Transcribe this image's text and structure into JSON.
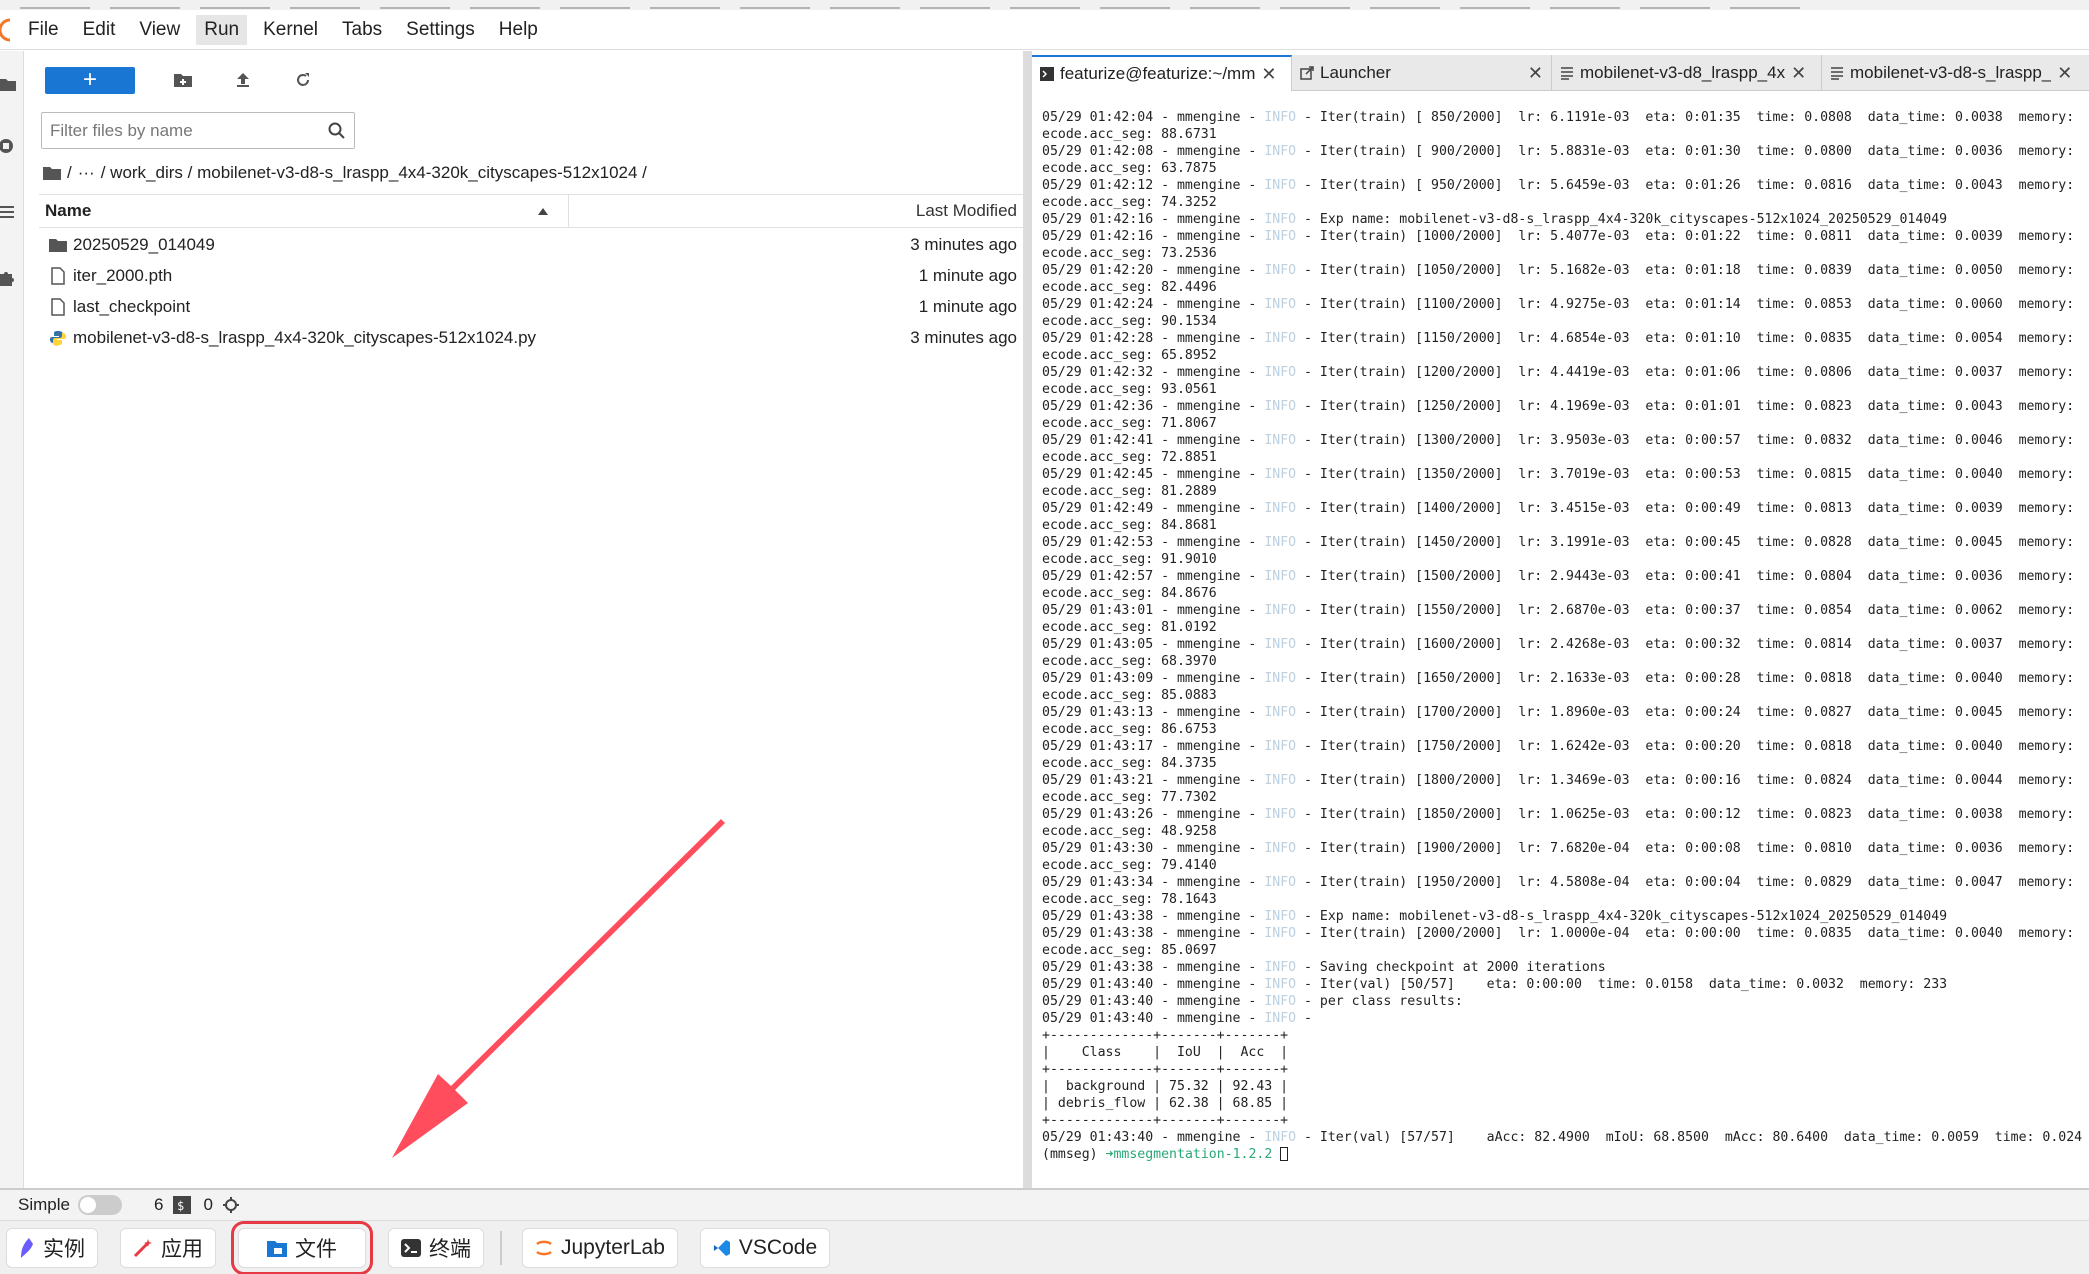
{
  "menubar": {
    "items": [
      "File",
      "Edit",
      "View",
      "Run",
      "Kernel",
      "Tabs",
      "Settings",
      "Help"
    ],
    "active_index": 3
  },
  "filebrowser": {
    "new_label": "+",
    "filter_placeholder": "Filter files by name",
    "breadcrumb": {
      "root": "/",
      "ellipsis": "···",
      "path": "/ work_dirs / mobilenet-v3-d8-s_lraspp_4x4-320k_cityscapes-512x1024 /"
    },
    "columns": {
      "name": "Name",
      "modified": "Last Modified"
    },
    "files": [
      {
        "name": "20250529_014049",
        "modified": "3 minutes ago",
        "icon": "folder-icon"
      },
      {
        "name": "iter_2000.pth",
        "modified": "1 minute ago",
        "icon": "file-icon"
      },
      {
        "name": "last_checkpoint",
        "modified": "1 minute ago",
        "icon": "file-icon"
      },
      {
        "name": "mobilenet-v3-d8-s_lraspp_4x4-320k_cityscapes-512x1024.py",
        "modified": "3 minutes ago",
        "icon": "python-file-icon"
      }
    ]
  },
  "terminal": {
    "tabs": [
      {
        "label": "featurize@featurize:~/mm",
        "icon": "terminal-icon",
        "active": true
      },
      {
        "label": "Launcher",
        "icon": "launcher-icon",
        "active": false
      },
      {
        "label": "mobilenet-v3-d8_lraspp_4x",
        "icon": "text-file-icon",
        "active": false
      },
      {
        "label": "mobilenet-v3-d8-s_lraspp_",
        "icon": "text-file-icon",
        "active": false
      }
    ],
    "lines": [
      {
        "pre": "05/29 01:42:04 - mmengine - ",
        "info": "INFO",
        "post": " - Iter(train) [ 850/2000]  lr: 6.1191e-03  eta: 0:01:35  time: 0.0808  data_time: 0.0038  memory:"
      },
      {
        "pre": "ecode.acc_seg: 88.6731",
        "info": "",
        "post": ""
      },
      {
        "pre": "05/29 01:42:08 - mmengine - ",
        "info": "INFO",
        "post": " - Iter(train) [ 900/2000]  lr: 5.8831e-03  eta: 0:01:30  time: 0.0800  data_time: 0.0036  memory:"
      },
      {
        "pre": "ecode.acc_seg: 63.7875",
        "info": "",
        "post": ""
      },
      {
        "pre": "05/29 01:42:12 - mmengine - ",
        "info": "INFO",
        "post": " - Iter(train) [ 950/2000]  lr: 5.6459e-03  eta: 0:01:26  time: 0.0816  data_time: 0.0043  memory:"
      },
      {
        "pre": "ecode.acc_seg: 74.3252",
        "info": "",
        "post": ""
      },
      {
        "pre": "05/29 01:42:16 - mmengine - ",
        "info": "INFO",
        "post": " - Exp name: mobilenet-v3-d8-s_lraspp_4x4-320k_cityscapes-512x1024_20250529_014049"
      },
      {
        "pre": "05/29 01:42:16 - mmengine - ",
        "info": "INFO",
        "post": " - Iter(train) [1000/2000]  lr: 5.4077e-03  eta: 0:01:22  time: 0.0811  data_time: 0.0039  memory:"
      },
      {
        "pre": "ecode.acc_seg: 73.2536",
        "info": "",
        "post": ""
      },
      {
        "pre": "05/29 01:42:20 - mmengine - ",
        "info": "INFO",
        "post": " - Iter(train) [1050/2000]  lr: 5.1682e-03  eta: 0:01:18  time: 0.0839  data_time: 0.0050  memory:"
      },
      {
        "pre": "ecode.acc_seg: 82.4496",
        "info": "",
        "post": ""
      },
      {
        "pre": "05/29 01:42:24 - mmengine - ",
        "info": "INFO",
        "post": " - Iter(train) [1100/2000]  lr: 4.9275e-03  eta: 0:01:14  time: 0.0853  data_time: 0.0060  memory:"
      },
      {
        "pre": "ecode.acc_seg: 90.1534",
        "info": "",
        "post": ""
      },
      {
        "pre": "05/29 01:42:28 - mmengine - ",
        "info": "INFO",
        "post": " - Iter(train) [1150/2000]  lr: 4.6854e-03  eta: 0:01:10  time: 0.0835  data_time: 0.0054  memory:"
      },
      {
        "pre": "ecode.acc_seg: 65.8952",
        "info": "",
        "post": ""
      },
      {
        "pre": "05/29 01:42:32 - mmengine - ",
        "info": "INFO",
        "post": " - Iter(train) [1200/2000]  lr: 4.4419e-03  eta: 0:01:06  time: 0.0806  data_time: 0.0037  memory:"
      },
      {
        "pre": "ecode.acc_seg: 93.0561",
        "info": "",
        "post": ""
      },
      {
        "pre": "05/29 01:42:36 - mmengine - ",
        "info": "INFO",
        "post": " - Iter(train) [1250/2000]  lr: 4.1969e-03  eta: 0:01:01  time: 0.0823  data_time: 0.0043  memory:"
      },
      {
        "pre": "ecode.acc_seg: 71.8067",
        "info": "",
        "post": ""
      },
      {
        "pre": "05/29 01:42:41 - mmengine - ",
        "info": "INFO",
        "post": " - Iter(train) [1300/2000]  lr: 3.9503e-03  eta: 0:00:57  time: 0.0832  data_time: 0.0046  memory:"
      },
      {
        "pre": "ecode.acc_seg: 72.8851",
        "info": "",
        "post": ""
      },
      {
        "pre": "05/29 01:42:45 - mmengine - ",
        "info": "INFO",
        "post": " - Iter(train) [1350/2000]  lr: 3.7019e-03  eta: 0:00:53  time: 0.0815  data_time: 0.0040  memory:"
      },
      {
        "pre": "ecode.acc_seg: 81.2889",
        "info": "",
        "post": ""
      },
      {
        "pre": "05/29 01:42:49 - mmengine - ",
        "info": "INFO",
        "post": " - Iter(train) [1400/2000]  lr: 3.4515e-03  eta: 0:00:49  time: 0.0813  data_time: 0.0039  memory:"
      },
      {
        "pre": "ecode.acc_seg: 84.8681",
        "info": "",
        "post": ""
      },
      {
        "pre": "05/29 01:42:53 - mmengine - ",
        "info": "INFO",
        "post": " - Iter(train) [1450/2000]  lr: 3.1991e-03  eta: 0:00:45  time: 0.0828  data_time: 0.0045  memory:"
      },
      {
        "pre": "ecode.acc_seg: 91.9010",
        "info": "",
        "post": ""
      },
      {
        "pre": "05/29 01:42:57 - mmengine - ",
        "info": "INFO",
        "post": " - Iter(train) [1500/2000]  lr: 2.9443e-03  eta: 0:00:41  time: 0.0804  data_time: 0.0036  memory:"
      },
      {
        "pre": "ecode.acc_seg: 84.8676",
        "info": "",
        "post": ""
      },
      {
        "pre": "05/29 01:43:01 - mmengine - ",
        "info": "INFO",
        "post": " - Iter(train) [1550/2000]  lr: 2.6870e-03  eta: 0:00:37  time: 0.0854  data_time: 0.0062  memory:"
      },
      {
        "pre": "ecode.acc_seg: 81.0192",
        "info": "",
        "post": ""
      },
      {
        "pre": "05/29 01:43:05 - mmengine - ",
        "info": "INFO",
        "post": " - Iter(train) [1600/2000]  lr: 2.4268e-03  eta: 0:00:32  time: 0.0814  data_time: 0.0037  memory:"
      },
      {
        "pre": "ecode.acc_seg: 68.3970",
        "info": "",
        "post": ""
      },
      {
        "pre": "05/29 01:43:09 - mmengine - ",
        "info": "INFO",
        "post": " - Iter(train) [1650/2000]  lr: 2.1633e-03  eta: 0:00:28  time: 0.0818  data_time: 0.0040  memory:"
      },
      {
        "pre": "ecode.acc_seg: 85.0883",
        "info": "",
        "post": ""
      },
      {
        "pre": "05/29 01:43:13 - mmengine - ",
        "info": "INFO",
        "post": " - Iter(train) [1700/2000]  lr: 1.8960e-03  eta: 0:00:24  time: 0.0827  data_time: 0.0045  memory:"
      },
      {
        "pre": "ecode.acc_seg: 86.6753",
        "info": "",
        "post": ""
      },
      {
        "pre": "05/29 01:43:17 - mmengine - ",
        "info": "INFO",
        "post": " - Iter(train) [1750/2000]  lr: 1.6242e-03  eta: 0:00:20  time: 0.0818  data_time: 0.0040  memory:"
      },
      {
        "pre": "ecode.acc_seg: 84.3735",
        "info": "",
        "post": ""
      },
      {
        "pre": "05/29 01:43:21 - mmengine - ",
        "info": "INFO",
        "post": " - Iter(train) [1800/2000]  lr: 1.3469e-03  eta: 0:00:16  time: 0.0824  data_time: 0.0044  memory:"
      },
      {
        "pre": "ecode.acc_seg: 77.7302",
        "info": "",
        "post": ""
      },
      {
        "pre": "05/29 01:43:26 - mmengine - ",
        "info": "INFO",
        "post": " - Iter(train) [1850/2000]  lr: 1.0625e-03  eta: 0:00:12  time: 0.0823  data_time: 0.0038  memory:"
      },
      {
        "pre": "ecode.acc_seg: 48.9258",
        "info": "",
        "post": ""
      },
      {
        "pre": "05/29 01:43:30 - mmengine - ",
        "info": "INFO",
        "post": " - Iter(train) [1900/2000]  lr: 7.6820e-04  eta: 0:00:08  time: 0.0810  data_time: 0.0036  memory:"
      },
      {
        "pre": "ecode.acc_seg: 79.4140",
        "info": "",
        "post": ""
      },
      {
        "pre": "05/29 01:43:34 - mmengine - ",
        "info": "INFO",
        "post": " - Iter(train) [1950/2000]  lr: 4.5808e-04  eta: 0:00:04  time: 0.0829  data_time: 0.0047  memory:"
      },
      {
        "pre": "ecode.acc_seg: 78.1643",
        "info": "",
        "post": ""
      },
      {
        "pre": "05/29 01:43:38 - mmengine - ",
        "info": "INFO",
        "post": " - Exp name: mobilenet-v3-d8-s_lraspp_4x4-320k_cityscapes-512x1024_20250529_014049"
      },
      {
        "pre": "05/29 01:43:38 - mmengine - ",
        "info": "INFO",
        "post": " - Iter(train) [2000/2000]  lr: 1.0000e-04  eta: 0:00:00  time: 0.0835  data_time: 0.0040  memory:"
      },
      {
        "pre": "ecode.acc_seg: 85.0697",
        "info": "",
        "post": ""
      },
      {
        "pre": "05/29 01:43:38 - mmengine - ",
        "info": "INFO",
        "post": " - Saving checkpoint at 2000 iterations"
      },
      {
        "pre": "05/29 01:43:40 - mmengine - ",
        "info": "INFO",
        "post": " - Iter(val) [50/57]    eta: 0:00:00  time: 0.0158  data_time: 0.0032  memory: 233"
      },
      {
        "pre": "05/29 01:43:40 - mmengine - ",
        "info": "INFO",
        "post": " - per class results:"
      },
      {
        "pre": "05/29 01:43:40 - mmengine - ",
        "info": "INFO",
        "post": " -"
      },
      {
        "pre": "+-------------+-------+-------+",
        "info": "",
        "post": ""
      },
      {
        "pre": "|    Class    |  IoU  |  Acc  |",
        "info": "",
        "post": ""
      },
      {
        "pre": "+-------------+-------+-------+",
        "info": "",
        "post": ""
      },
      {
        "pre": "|  background | 75.32 | 92.43 |",
        "info": "",
        "post": ""
      },
      {
        "pre": "| debris_flow | 62.38 | 68.85 |",
        "info": "",
        "post": ""
      },
      {
        "pre": "+-------------+-------+-------+",
        "info": "",
        "post": ""
      },
      {
        "pre": "05/29 01:43:40 - mmengine - ",
        "info": "INFO",
        "post": " - Iter(val) [57/57]    aAcc: 82.4900  mIoU: 68.8500  mAcc: 80.6400  data_time: 0.0059  time: 0.024"
      }
    ],
    "prompt_env": "(mmseg) ",
    "prompt_arrow": "➜",
    "prompt_dir": "mmsegmentation-1.2.2"
  },
  "statusbar": {
    "mode_label": "Simple",
    "kernels_count": "6",
    "terminals_count": "0"
  },
  "taskbar": {
    "buttons": [
      {
        "label": "实例",
        "icon": "instance-icon",
        "highlighted": false
      },
      {
        "label": "应用",
        "icon": "apps-icon",
        "highlighted": false
      },
      {
        "label": "文件",
        "icon": "files-icon",
        "highlighted": true
      },
      {
        "label": "终端",
        "icon": "terminal-icon",
        "highlighted": false
      },
      {
        "label": "JupyterLab",
        "icon": "jupyter-icon",
        "highlighted": false
      },
      {
        "label": "VSCode",
        "icon": "vscode-icon",
        "highlighted": false
      }
    ]
  },
  "colors": {
    "accent": "#1976d2",
    "annotation_red": "#e53945",
    "prompt_green": "#2aa876"
  }
}
